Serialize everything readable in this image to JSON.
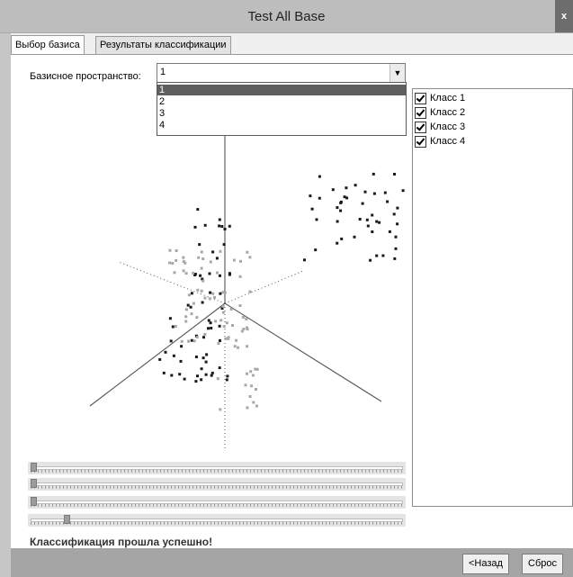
{
  "window": {
    "title": "Test All Base",
    "close_label": "x"
  },
  "tabs": [
    {
      "label": "Выбор базиса",
      "active": true
    },
    {
      "label": "Результаты классификации",
      "active": false
    }
  ],
  "basis": {
    "label": "Базисное пространство:",
    "selected": "1",
    "options": [
      "1",
      "2",
      "3",
      "4"
    ],
    "dropdown_open": true,
    "dropdown_arrow_icon": "chevron-down-icon"
  },
  "classes": [
    {
      "label": "Класс 1",
      "checked": true
    },
    {
      "label": "Класс 2",
      "checked": true
    },
    {
      "label": "Класс 3",
      "checked": true
    },
    {
      "label": "Класс 4",
      "checked": true
    }
  ],
  "sliders": [
    {
      "name": "rotation-slider-1",
      "value": 0.0
    },
    {
      "name": "rotation-slider-2",
      "value": 0.0
    },
    {
      "name": "rotation-slider-3",
      "value": 0.0
    },
    {
      "name": "rotation-slider-4",
      "value": 0.09
    }
  ],
  "status_text": "Классификация прошла успешно!",
  "buttons": {
    "back": "<Назад",
    "reset": "Сброс"
  },
  "colors": {
    "point_dark": "#1a1a1a",
    "point_light": "#a8a8a8",
    "axis": "#555555"
  }
}
